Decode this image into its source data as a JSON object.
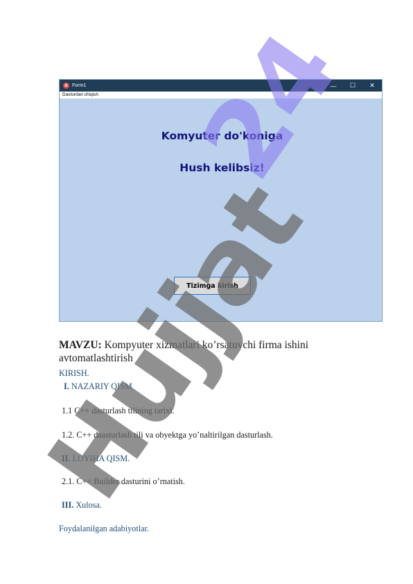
{
  "window": {
    "title": "Form1",
    "app_icon_glyph": "✿",
    "controls": {
      "minimize": "—",
      "maximize": "☐",
      "close": "✕"
    },
    "menu_item": "Dasturdan chiqish",
    "heading_line1": "Komyuter do'koniga",
    "heading_line2": "Hush kelibsiz!",
    "button_label": "Tizimga kirish"
  },
  "document": {
    "topic_label": "MAVZU:",
    "topic_text": " Kompyuter xizmatlari ko’rsatuvchi firma ishini",
    "topic_text2": "avtomatlashtirish",
    "intro": "KIRISH.",
    "part1_num": "I.",
    "part1_text": " NAZARIY QISM",
    "item_1_1": "1.1 C++   dasturlash tilining tarixi.",
    "item_1_2": "1.2. C++ daasturlash tili va obyektga yo’naltirilgan dasturlash.",
    "part2_num": "II.",
    "part2_text": " LOYIHA QISM.",
    "item_2_1": "2.1. C++ Builder dasturini o’rnatish.",
    "part3_num": "III.",
    "part3_text": " Xulosa.",
    "references": "Foydalanilgan adabiyotlar."
  },
  "watermark": {
    "text_dark": "Hujjat",
    "text_light": "24",
    "color_dark": "#6b6b6b",
    "color_light": "#8a7cf0"
  },
  "colors": {
    "titlebar": "#1f3d57",
    "window_bg": "#bcd1ec",
    "heading": "#14137e",
    "section_blue": "#1e4e79"
  }
}
